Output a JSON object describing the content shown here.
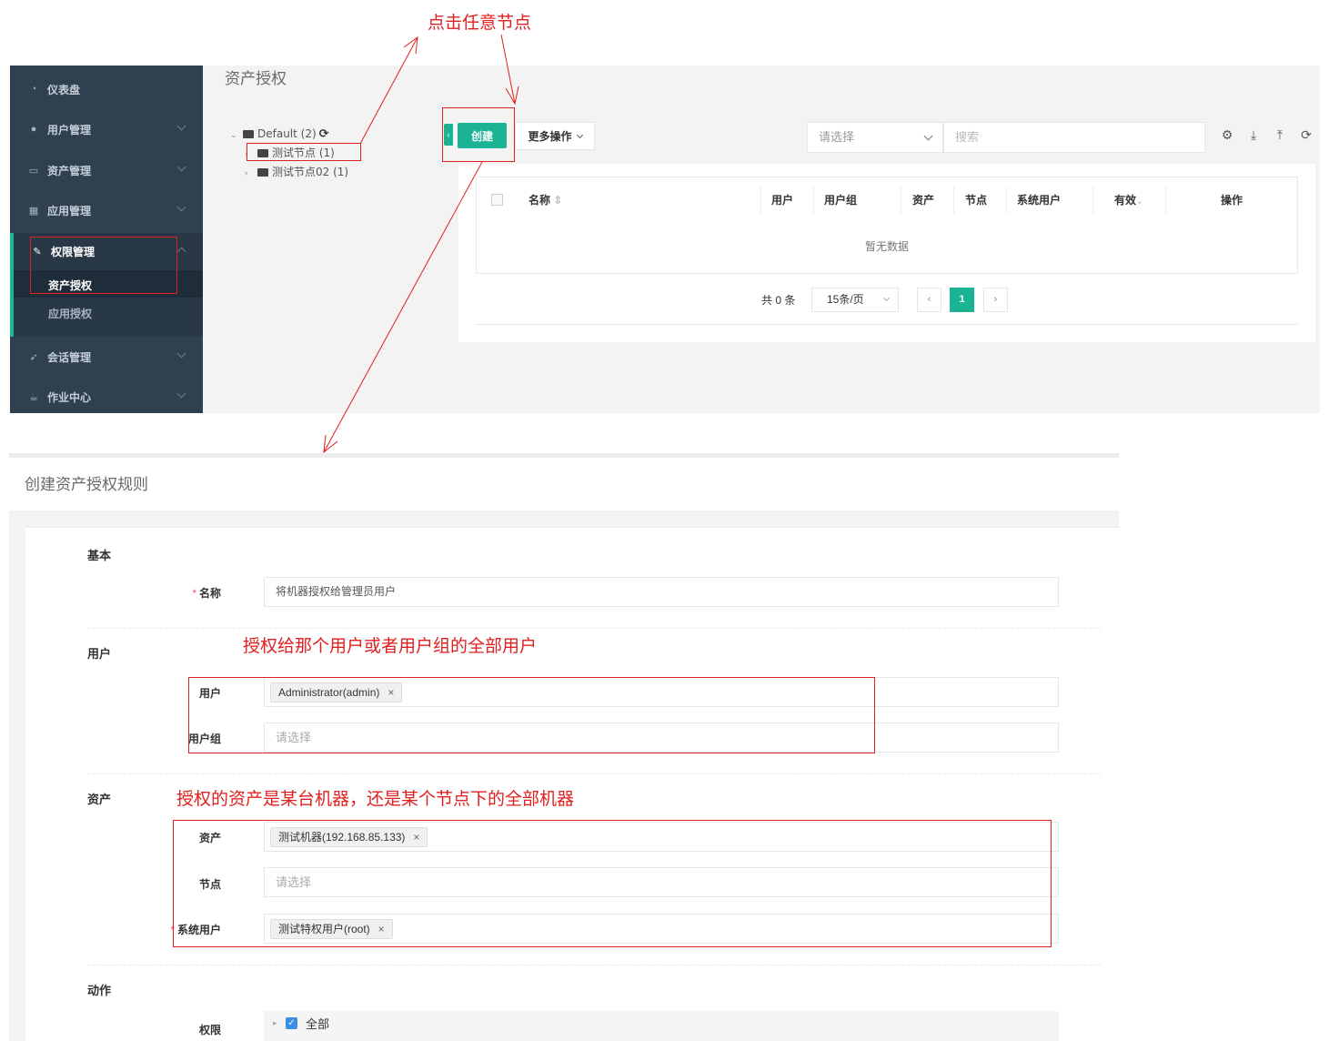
{
  "sidebar": {
    "items": [
      {
        "label": "仪表盘",
        "icon": "dashboard-icon"
      },
      {
        "label": "用户管理",
        "icon": "users-icon"
      },
      {
        "label": "资产管理",
        "icon": "inbox-icon"
      },
      {
        "label": "应用管理",
        "icon": "grid-icon"
      },
      {
        "label": "权限管理",
        "icon": "edit-icon"
      },
      {
        "label": "会话管理",
        "icon": "rocket-icon"
      },
      {
        "label": "作业中心",
        "icon": "coffee-icon"
      }
    ],
    "sub_items": [
      "资产授权",
      "应用授权"
    ]
  },
  "top": {
    "page_title": "资产授权",
    "tree": {
      "root": "Default (2)",
      "nodes": [
        "测试节点 (1)",
        "测试节点02 (1)"
      ]
    },
    "create_label": "创建",
    "more_label": "更多操作",
    "select_placeholder": "请选择",
    "search_placeholder": "搜索",
    "columns": [
      "名称",
      "用户",
      "用户组",
      "资产",
      "节点",
      "系统用户",
      "有效",
      "操作"
    ],
    "empty_text": "暂无数据",
    "pager": {
      "total": "共 0 条",
      "page_size": "15条/页",
      "current": "1"
    }
  },
  "form": {
    "page_title": "创建资产授权规则",
    "sections": {
      "basic": "基本",
      "user": "用户",
      "asset": "资产",
      "action": "动作"
    },
    "labels": {
      "name": "名称",
      "users": "用户",
      "user_groups": "用户组",
      "assets": "资产",
      "nodes": "节点",
      "system_users": "系统用户",
      "permission": "权限"
    },
    "values": {
      "name": "将机器授权给管理员用户",
      "user_tag": "Administrator(admin)",
      "user_groups_placeholder": "请选择",
      "asset_tag": "测试机器(192.168.85.133)",
      "nodes_placeholder": "请选择",
      "system_user_tag": "测试特权用户(root)",
      "permission_all": "全部"
    },
    "remove_symbol": "×",
    "required_mark": "*"
  },
  "annotations": {
    "click_node": "点击任意节点",
    "user_note": "授权给那个用户或者用户组的全部用户",
    "asset_note": "授权的资产是某台机器，还是某个节点下的全部机器"
  },
  "colors": {
    "sidebar_bg": "#2f4050",
    "accent": "#1ab394",
    "annotation": "#e02020"
  }
}
